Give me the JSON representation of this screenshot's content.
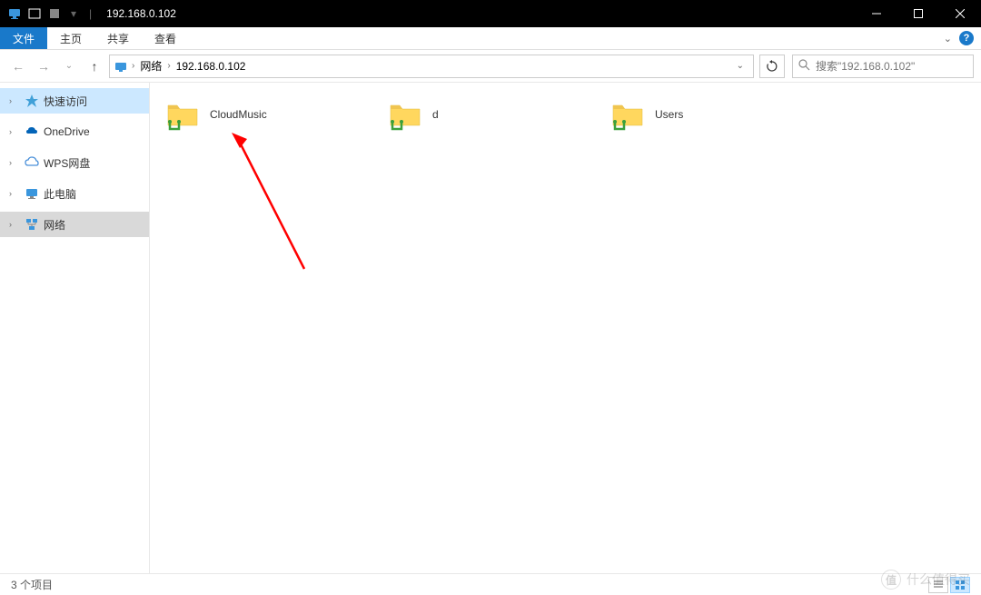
{
  "titlebar": {
    "title": "192.168.0.102"
  },
  "ribbon": {
    "tabs": [
      "文件",
      "主页",
      "共享",
      "查看"
    ],
    "active_index": 0
  },
  "address": {
    "crumbs": [
      "网络",
      "192.168.0.102"
    ]
  },
  "search": {
    "placeholder": "搜索\"192.168.0.102\""
  },
  "navpane": {
    "items": [
      {
        "label": "快速访问",
        "icon": "star",
        "selected": true,
        "expandable": true
      },
      {
        "label": "OneDrive",
        "icon": "onedrive",
        "expandable": true
      },
      {
        "label": "WPS网盘",
        "icon": "wps",
        "expandable": true
      },
      {
        "label": "此电脑",
        "icon": "pc",
        "expandable": true
      },
      {
        "label": "网络",
        "icon": "network",
        "highlight": true,
        "expandable": true
      }
    ]
  },
  "content": {
    "folders": [
      {
        "label": "CloudMusic"
      },
      {
        "label": "d"
      },
      {
        "label": "Users"
      }
    ]
  },
  "statusbar": {
    "text": "3 个项目"
  },
  "watermark": {
    "text": "什么值得买",
    "badge": "值"
  }
}
